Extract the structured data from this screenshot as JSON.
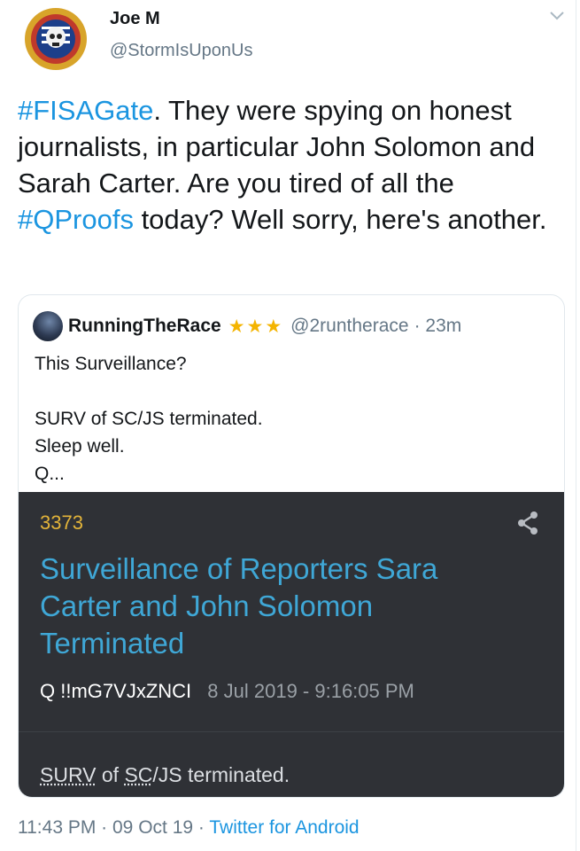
{
  "author": {
    "display_name": "Joe M",
    "handle": "@StormIsUponUs",
    "avatar_text": "MAKE AMERICA GREAT AGAIN"
  },
  "tweet": {
    "parts": [
      {
        "text": "#FISAGate",
        "type": "hashtag"
      },
      {
        "text": ". They were spying on honest journalists, in particular John Solomon and Sarah Carter. Are you tired of all the ",
        "type": "text"
      },
      {
        "text": "#QProofs",
        "type": "hashtag"
      },
      {
        "text": " today? Well sorry, here's another.",
        "type": "text"
      }
    ]
  },
  "quoted": {
    "display_name": "RunningTheRace",
    "stars": "★★★",
    "handle": "@2runtherace",
    "time": "· 23m",
    "lines": [
      "This Surveillance?",
      "",
      "SURV of SC/JS terminated.",
      "Sleep well.",
      "Q..."
    ],
    "post": {
      "number": "3373",
      "title": "Surveillance of Reporters Sara Carter and John Solomon Terminated",
      "q": "Q",
      "tripcode": "!!mG7VJxZNCI",
      "date": "8 Jul 2019 - 9:16:05 PM",
      "body_surv": "SURV",
      "body_of": " of ",
      "body_scjs": "SC",
      "body_rest": "/JS terminated."
    }
  },
  "footer": {
    "time": "11:43 PM",
    "sep1": " · ",
    "date": "09 Oct 19",
    "sep2": " · ",
    "source": "Twitter for Android"
  },
  "colors": {
    "link": "#1b95e0",
    "panel": "#2f3136",
    "post_number": "#e3b43a",
    "post_title": "#3fa7d6",
    "star": "#f4b400"
  },
  "icons": [
    "mega-avatar-icon",
    "chevron-down-icon",
    "share-icon"
  ]
}
